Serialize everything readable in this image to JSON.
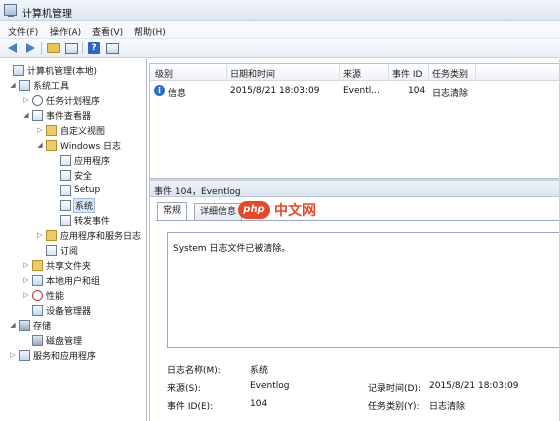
{
  "window": {
    "title": "计算机管理"
  },
  "menu": [
    {
      "label": "文件(F)"
    },
    {
      "label": "操作(A)"
    },
    {
      "label": "查看(V)"
    },
    {
      "label": "帮助(H)"
    }
  ],
  "toolbar": {
    "buttons": [
      {
        "icon": "back-arrow-icon"
      },
      {
        "icon": "forward-arrow-icon"
      },
      {
        "icon": "up-folder-icon"
      },
      {
        "icon": "show-hide-tree-icon"
      },
      {
        "icon": "help-icon",
        "glyph": "?"
      },
      {
        "icon": "properties-icon"
      }
    ]
  },
  "tree": {
    "items": [
      {
        "label": "计算机管理(本地)",
        "exp": "",
        "icon": "computer"
      },
      {
        "label": "系统工具",
        "exp": "◢",
        "icon": "tools"
      },
      {
        "label": "任务计划程序",
        "exp": "▷",
        "icon": "clock"
      },
      {
        "label": "事件查看器",
        "exp": "◢",
        "icon": "log"
      },
      {
        "label": "自定义视图",
        "exp": "▷",
        "icon": "folder"
      },
      {
        "label": "Windows 日志",
        "exp": "◢",
        "icon": "folder"
      },
      {
        "label": "应用程序",
        "exp": "",
        "icon": "log"
      },
      {
        "label": "安全",
        "exp": "",
        "icon": "log"
      },
      {
        "label": "Setup",
        "exp": "",
        "icon": "log"
      },
      {
        "label": "系统",
        "exp": "",
        "icon": "log"
      },
      {
        "label": "转发事件",
        "exp": "",
        "icon": "log"
      },
      {
        "label": "应用程序和服务日志",
        "exp": "▷",
        "icon": "folder"
      },
      {
        "label": "订阅",
        "exp": "",
        "icon": "log"
      },
      {
        "label": "共享文件夹",
        "exp": "▷",
        "icon": "folder"
      },
      {
        "label": "本地用户和组",
        "exp": "▷",
        "icon": "users"
      },
      {
        "label": "性能",
        "exp": "▷",
        "icon": "perf"
      },
      {
        "label": "设备管理器",
        "exp": "",
        "icon": "device"
      },
      {
        "label": "存储",
        "exp": "◢",
        "icon": "storage"
      },
      {
        "label": "磁盘管理",
        "exp": "",
        "icon": "disk"
      },
      {
        "label": "服务和应用程序",
        "exp": "▷",
        "icon": "services"
      }
    ]
  },
  "event_list": {
    "columns": [
      "级别",
      "日期和时间",
      "来源",
      "事件 ID",
      "任务类别"
    ],
    "rows": [
      {
        "level": "信息",
        "datetime": "2015/8/21 18:03:09",
        "source": "Eventl...",
        "event_id": "104",
        "category": "日志清除"
      }
    ]
  },
  "detail": {
    "header": "事件 104，Eventlog",
    "tabs": [
      {
        "label": "常规"
      },
      {
        "label": "详细信息"
      }
    ],
    "description": "System 日志文件已被清除。",
    "fields": {
      "log_name_label": "日志名称(M):",
      "log_name_value": "系统",
      "source_label": "来源(S):",
      "source_value": "Eventlog",
      "logged_label": "记录时间(D):",
      "logged_value": "2015/8/21 18:03:09",
      "event_id_label": "事件 ID(E):",
      "event_id_value": "104",
      "task_label": "任务类别(Y):",
      "task_value": "日志清除"
    }
  },
  "watermark": {
    "badge": "php",
    "text": "中文网"
  }
}
